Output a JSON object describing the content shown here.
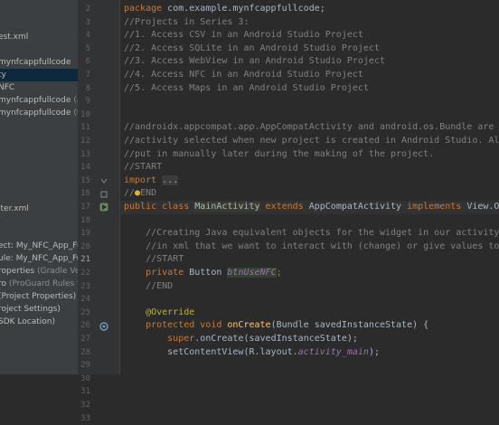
{
  "sidebar": {
    "items": [
      {
        "text": "est.xml",
        "top": 0
      },
      {
        "text": "mynfcappfullcode",
        "top": 0
      },
      {
        "text": "ty",
        "top": 0,
        "selected": true
      },
      {
        "text": "NFC",
        "top": 0
      },
      {
        "text": "mynfcappfullcode",
        "muted": "(and",
        "top": 0
      },
      {
        "text": "mynfcappfullcode",
        "muted": "(test",
        "top": 0
      },
      {
        "text": "lter.xml",
        "top": 0
      },
      {
        "text": "ect: My_NFC_App_Full_",
        "top": 0
      },
      {
        "text": "ule: My_NFC_App_Full_",
        "top": 0
      },
      {
        "text": "roperties",
        "muted": "(Gradle Versi",
        "top": 0
      },
      {
        "text": "ro",
        "muted": "(ProGuard Rules for",
        "top": 0
      },
      {
        "text": "(Project Properties)",
        "top": 0
      },
      {
        "text": "roject Settings)",
        "top": 0
      },
      {
        "text": "SDK Location)",
        "top": 0
      }
    ]
  },
  "gutter": {
    "line_numbers": [
      "2",
      "3",
      "4",
      "5",
      "6",
      "7",
      "8",
      "9",
      "10",
      "11",
      "12",
      "13",
      "14",
      "15",
      "16",
      "17",
      "18",
      "19",
      "20",
      "21",
      "22",
      "23",
      "24",
      "25",
      "26",
      "27",
      "28",
      "29",
      "30",
      "31",
      "32",
      "33"
    ],
    "current_line": "21"
  },
  "code": {
    "l1_kw": "package ",
    "l1_rest": "com.example.mynfcappfullcode;",
    "l2": "//Projects in Series 3:",
    "l3": "//1. Access CSV in an Android Studio Project",
    "l4": "//2. Access SQLite in an Android Studio Project",
    "l5": "//3. Access WebView in an Android Studio Project",
    "l6": "//4. Access NFC in an Android Studio Project",
    "l7": "//5. Access Maps in an Android Studio Project",
    "l10": "//androidx.appcompat.app.AppCompatActivity and android.os.Bundle are put in b",
    "l11": "//activity selected when new project is created in Android Studio. All of the",
    "l12": "//put in manually later during the making of the project.",
    "l13": "//START",
    "l14_kw": "import ",
    "l14_fold": "...",
    "l15_a": "//",
    "l15_b": "END",
    "l16_kw1": "public class ",
    "l16_cls": "MainActivity",
    "l16_kw2": " extends ",
    "l16_sup": "AppCompatActivity",
    "l16_kw3": " implements ",
    "l16_iface": "View.OnClickLi",
    "l18": "    //Creating Java equivalent objects for the widget in our activity main use",
    "l19": "    //in xml that we want to interact with (change) or give values to in some",
    "l20": "    //START",
    "l21_kw": "    private ",
    "l21_type": "Button ",
    "l21_var": "btnUseNFC",
    "l21_end": ";",
    "l22": "    //END",
    "l24": "    @Override",
    "l25_kw": "    protected void ",
    "l25_fn": "onCreate",
    "l25_rest": "(Bundle savedInstanceState) {",
    "l26_kw": "        super",
    "l26_rest": ".onCreate(savedInstanceState);",
    "l27_a": "        setContentView(R.layout.",
    "l27_it": "activity_main",
    "l27_b": ");"
  }
}
